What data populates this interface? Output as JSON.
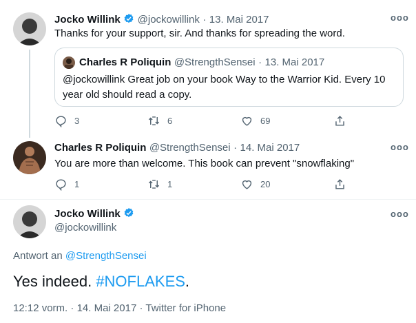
{
  "tweet1": {
    "name": "Jocko Willink",
    "handle": "@jockowillink",
    "sep": "·",
    "date": "13. Mai 2017",
    "text": "Thanks for your support, sir. And thanks for spreading the word.",
    "quote": {
      "name": "Charles R Poliquin",
      "handle": "@StrengthSensei",
      "sep": "·",
      "date": "13. Mai 2017",
      "text": "@jockowillink Great job on your book Way to the Warrior Kid. Every 10 year old should read a copy."
    },
    "replies": "3",
    "retweets": "6",
    "likes": "69"
  },
  "tweet2": {
    "name": "Charles R Poliquin",
    "handle": "@StrengthSensei",
    "sep": "·",
    "date": "14. Mai 2017",
    "text": "You are more than welcome. This book can prevent \"snowflaking\"",
    "replies": "1",
    "retweets": "1",
    "likes": "20"
  },
  "main": {
    "name": "Jocko Willink",
    "handle": "@jockowillink",
    "reply_prefix": "Antwort an",
    "reply_to": "@StrengthSensei",
    "text_prefix": "Yes indeed.",
    "hashtag": "#NOFLAKES",
    "text_suffix": ".",
    "time": "12:12 vorm.",
    "sep": "·",
    "date": "14. Mai 2017",
    "source": "Twitter for iPhone"
  },
  "more_label": "ooo",
  "colors": {
    "accent": "#1d9bf0",
    "muted": "#536471",
    "border": "#cfd9de"
  }
}
